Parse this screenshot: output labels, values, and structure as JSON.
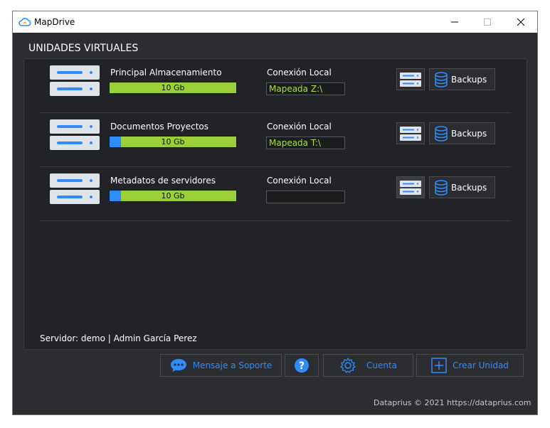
{
  "window": {
    "title": "MapDrive",
    "icon": "cloud-icon"
  },
  "header": {
    "section_title": "UNIDADES VIRTUALES"
  },
  "units": [
    {
      "name": "Principal Almacenamiento",
      "capacity_label": "10 Gb",
      "usage_fraction": 0.0,
      "connection_label": "Conexión Local",
      "connection_value": "Mapeada Z:\\",
      "backup_label": "Backups"
    },
    {
      "name": "Documentos Proyectos",
      "capacity_label": "10 Gb",
      "usage_fraction": 0.09,
      "connection_label": "Conexión Local",
      "connection_value": "Mapeada T:\\",
      "backup_label": "Backups"
    },
    {
      "name": "Metadatos de servidores",
      "capacity_label": "10 Gb",
      "usage_fraction": 0.09,
      "connection_label": "Conexión Local",
      "connection_value": "",
      "backup_label": "Backups"
    }
  ],
  "status": {
    "server_info": "Servidor: demo | Admin García Perez"
  },
  "actions": {
    "support_label": "Mensaje a Soporte",
    "help_icon": "question-icon",
    "account_label": "Cuenta",
    "create_label": "Crear Unidad"
  },
  "footer": {
    "copyright": "Dataprius © 2021 https://dataprius.com"
  },
  "colors": {
    "accent": "#2f8cff",
    "bar_free": "#9bd03a",
    "mapped_text": "#a9e23f",
    "background": "#2b2d31"
  }
}
